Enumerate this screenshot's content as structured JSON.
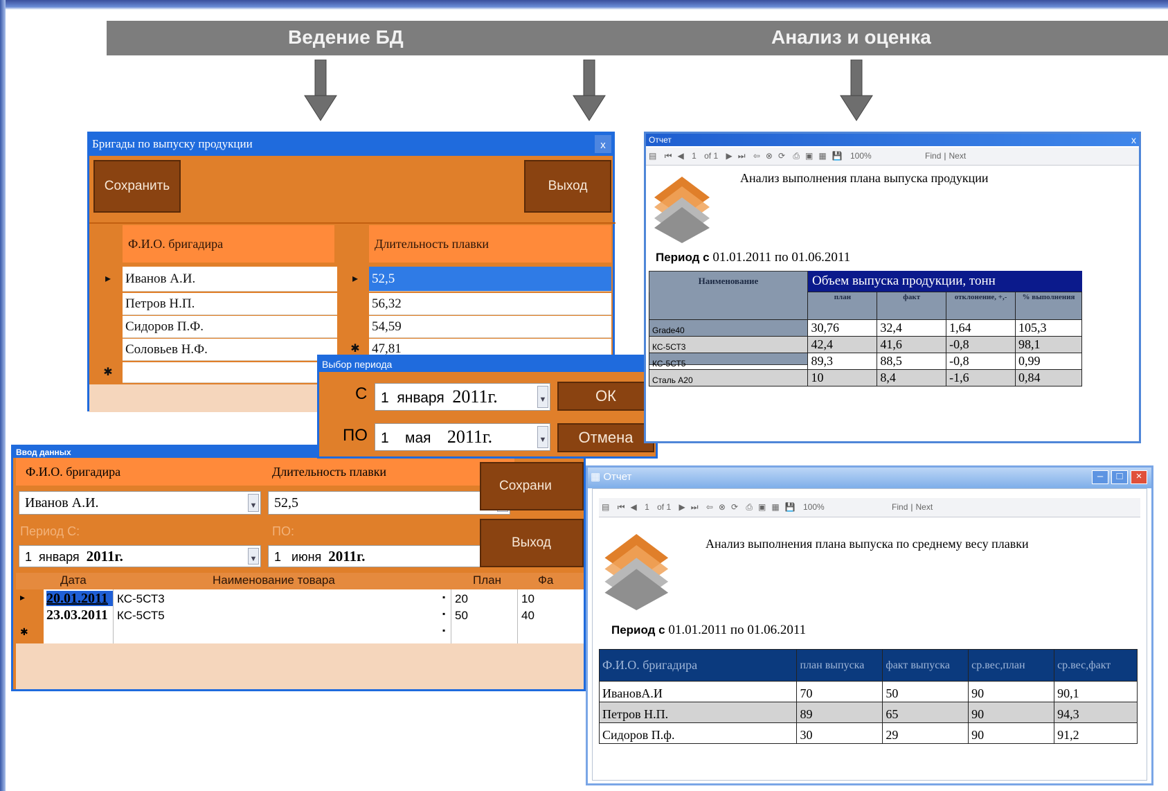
{
  "banner": {
    "left": "Ведение БД",
    "right": "Анализ и оценка"
  },
  "brigades": {
    "title": "Бригады по выпуску продукции",
    "close": "x",
    "save": "Сохранить",
    "exit": "Выход",
    "col_name": "Ф.И.О. бригадира",
    "col_duration": "Длительность плавки",
    "names": [
      "Иванов А.И.",
      "Петров Н.П.",
      "Сидоров П.Ф.",
      "Соловьев Н.Ф."
    ],
    "durations": [
      "52,5",
      "56,32",
      "54,59",
      "47,81"
    ],
    "row_marker": "▸",
    "new_marker": "✱"
  },
  "period": {
    "title": "Выбор периода",
    "from_label": "С",
    "to_label": "ПО",
    "from_day": "1",
    "from_month": "января",
    "from_year": "2011г.",
    "to_day": "1",
    "to_month": "мая",
    "to_year": "2011г.",
    "ok": "ОК",
    "cancel": "Отмена"
  },
  "entry": {
    "title": "Ввод данных",
    "col_name": "Ф.И.О. бригадира",
    "col_duration": "Длительность плавки",
    "name_value": "Иванов А.И.",
    "duration_value": "52,5",
    "period_from_label": "Период С:",
    "period_to_label": "ПО:",
    "from_day": "1",
    "from_month": "января",
    "from_year": "2011г.",
    "to_day": "1",
    "to_month": "июня",
    "to_year": "2011г.",
    "save": "Сохрани",
    "exit": "Выход",
    "grid_headers": [
      "Дата",
      "Наименование товара",
      "План",
      "Фа"
    ],
    "rows": [
      {
        "date": "20.01.2011",
        "name": "КС-5СТ3",
        "plan": "20",
        "fact": "10"
      },
      {
        "date": "23.03.2011",
        "name": "КС-5СТ5",
        "plan": "50",
        "fact": "40"
      }
    ]
  },
  "report1": {
    "title": "Отчет",
    "close": "x",
    "page": "1",
    "of": "of 1",
    "zoom": "100%",
    "find": "Find",
    "next": "Next",
    "heading": "Анализ выполнения плана выпуска продукции",
    "period_label": "Период с",
    "period_value": "01.01.2011 по 01.06.2011",
    "col_name": "Наименование",
    "group_header": "Объем выпуска продукции, тонн",
    "sub_headers": [
      "план",
      "факт",
      "отклонение, +,-",
      "% выполнения"
    ],
    "rows": [
      {
        "name": "Grade40",
        "plan": "30,76",
        "fact": "32,4",
        "dev": "1,64",
        "pct": "105,3"
      },
      {
        "name": "КС-5СТ3",
        "plan": "42,4",
        "fact": "41,6",
        "dev": "-0,8",
        "pct": "98,1"
      },
      {
        "name": "КС-5СТ5",
        "plan": "89,3",
        "fact": "88,5",
        "dev": "-0,8",
        "pct": "0,99"
      },
      {
        "name": "Сталь А20",
        "plan": "10",
        "fact": "8,4",
        "dev": "-1,6",
        "pct": "0,84"
      }
    ]
  },
  "report2": {
    "title": "Отчет",
    "page": "1",
    "of": "of 1",
    "zoom": "100%",
    "find": "Find",
    "next": "Next",
    "heading": "Анализ выполнения плана выпуска по среднему весу плавки",
    "period_label": "Период с",
    "period_value": "01.01.2011 по 01.06.2011",
    "headers": [
      "Ф.И.О. бригадира",
      "план выпуска",
      "факт выпуска",
      "ср.вес,план",
      "ср.вес,факт"
    ],
    "rows": [
      {
        "name": "ИвановА.И",
        "plan": "70",
        "fact": "50",
        "avg_plan": "90",
        "avg_fact": "90,1"
      },
      {
        "name": "Петров Н.П.",
        "plan": "89",
        "fact": "65",
        "avg_plan": "90",
        "avg_fact": "94,3"
      },
      {
        "name": "Сидоров П.ф.",
        "plan": "30",
        "fact": "29",
        "avg_plan": "90",
        "avg_fact": "91,2"
      }
    ]
  }
}
